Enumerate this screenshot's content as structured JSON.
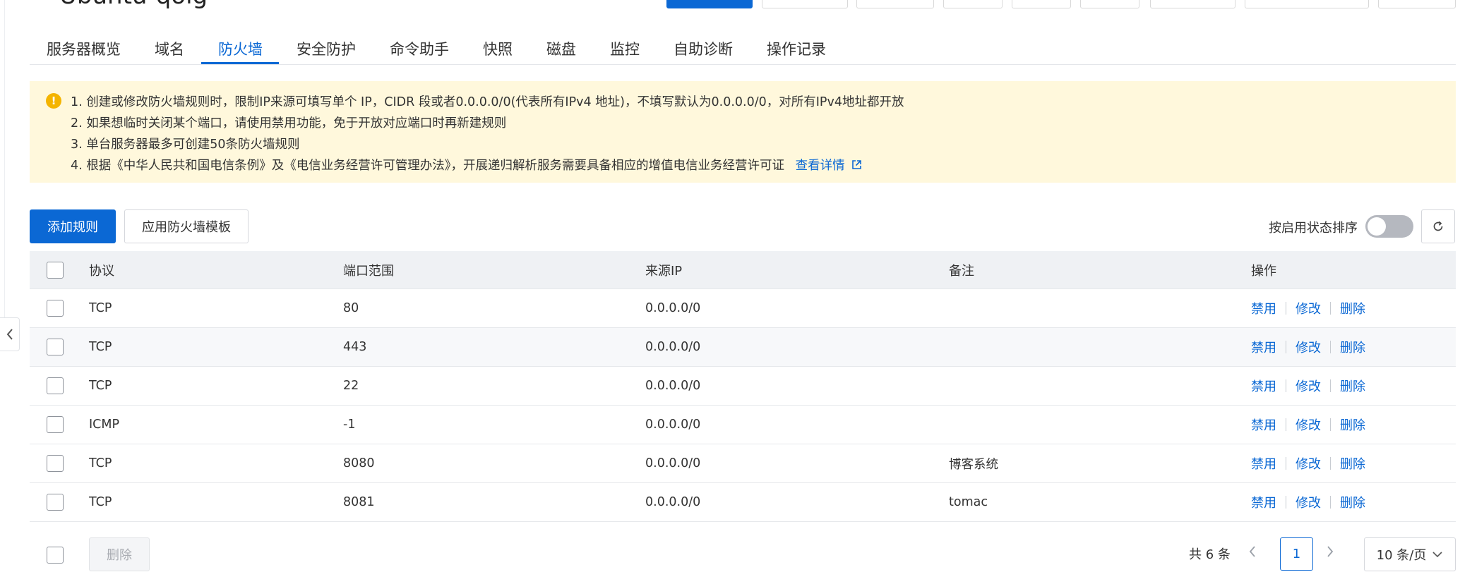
{
  "header": {
    "title": "Ubuntu-qolg"
  },
  "tabs": [
    {
      "label": "服务器概览"
    },
    {
      "label": "域名"
    },
    {
      "label": "防火墙"
    },
    {
      "label": "安全防护"
    },
    {
      "label": "命令助手"
    },
    {
      "label": "快照"
    },
    {
      "label": "磁盘"
    },
    {
      "label": "监控"
    },
    {
      "label": "自助诊断"
    },
    {
      "label": "操作记录"
    }
  ],
  "active_tab": "防火墙",
  "notice": {
    "lines": [
      "1. 创建或修改防火墙规则时，限制IP来源可填写单个 IP，CIDR 段或者0.0.0.0/0(代表所有IPv4 地址)，不填写默认为0.0.0.0/0，对所有IPv4地址都开放",
      "2. 如果想临时关闭某个端口，请使用禁用功能，免于开放对应端口时再新建规则",
      "3. 单台服务器最多可创建50条防火墙规则",
      "4. 根据《中华人民共和国电信条例》及《电信业务经营许可管理办法》，开展递归解析服务需要具备相应的增值电信业务经营许可证"
    ],
    "link_label": "查看详情"
  },
  "toolbar": {
    "add_rule": "添加规则",
    "apply_template": "应用防火墙模板",
    "sort_label": "按启用状态排序"
  },
  "table": {
    "headers": {
      "protocol": "协议",
      "port_range": "端口范围",
      "source_ip": "来源IP",
      "note": "备注",
      "actions": "操作"
    },
    "action_labels": {
      "disable": "禁用",
      "edit": "修改",
      "delete": "删除"
    },
    "rows": [
      {
        "protocol": "TCP",
        "port": "80",
        "ip": "0.0.0.0/0",
        "note": ""
      },
      {
        "protocol": "TCP",
        "port": "443",
        "ip": "0.0.0.0/0",
        "note": ""
      },
      {
        "protocol": "TCP",
        "port": "22",
        "ip": "0.0.0.0/0",
        "note": ""
      },
      {
        "protocol": "ICMP",
        "port": "-1",
        "ip": "0.0.0.0/0",
        "note": ""
      },
      {
        "protocol": "TCP",
        "port": "8080",
        "ip": "0.0.0.0/0",
        "note": "博客系统"
      },
      {
        "protocol": "TCP",
        "port": "8081",
        "ip": "0.0.0.0/0",
        "note": "tomac"
      }
    ]
  },
  "footer": {
    "delete_label": "删除",
    "total": "共 6 条",
    "current_page": "1",
    "page_size": "10 条/页"
  },
  "colors": {
    "accent": "#0b68d4",
    "notice_bg": "#fff8dc",
    "warning_icon": "#f4b400"
  },
  "icons": {
    "warning": "exclamation-circle-icon",
    "external_link": "external-link-icon",
    "refresh": "refresh-icon",
    "chevron_left": "chevron-left-icon",
    "chevron_right": "chevron-right-icon",
    "chevron_down": "chevron-down-icon"
  }
}
